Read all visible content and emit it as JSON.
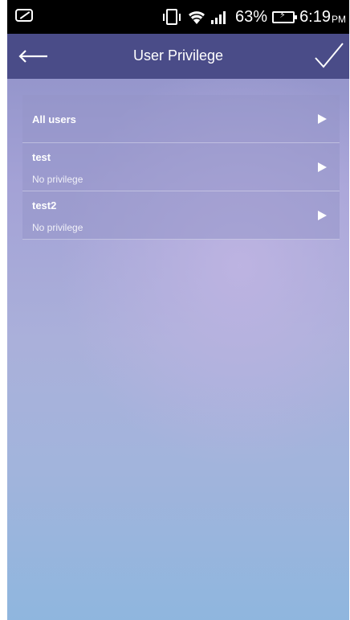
{
  "status_bar": {
    "battery_percent": "63%",
    "time": "6:19",
    "time_suffix": "PM",
    "icons": [
      "screen-capture-icon",
      "vibrate-icon",
      "wifi-icon",
      "signal-icon",
      "battery-charging-icon"
    ]
  },
  "app_bar": {
    "title": "User Privilege",
    "back_icon": "back-arrow-icon",
    "confirm_icon": "checkmark-icon",
    "background_color": "#4a4c88"
  },
  "users": [
    {
      "name": "All users",
      "privilege": ""
    },
    {
      "name": "test",
      "privilege": "No privilege"
    },
    {
      "name": "test2",
      "privilege": "No privilege"
    }
  ]
}
